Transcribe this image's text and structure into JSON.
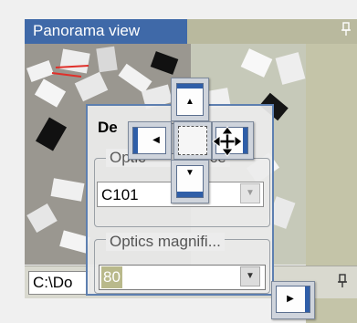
{
  "panorama": {
    "title": "Panorama view",
    "pin_glyph": "⬈"
  },
  "floating_panel": {
    "title_partial": "De",
    "group1_legend": "Optic",
    "group1_legend_tail": "ce",
    "combo1_value": "C101",
    "group2_legend": "Optics magnifi...",
    "combo2_value": "80"
  },
  "bottom": {
    "path_text": "C:\\Do",
    "pin_glyph": "⬈"
  },
  "icons": {
    "dock_up": "triangle-up",
    "dock_down": "triangle-down",
    "dock_left": "triangle-left",
    "dock_right": "triangle-right",
    "cursor": "move-cursor",
    "dropdown": "triangle-down"
  },
  "colors": {
    "title_active": "#3f69a8",
    "title_inactive": "#b9b99e",
    "guide_bar": "#2f5ea8",
    "selection": "#b9b98b"
  }
}
